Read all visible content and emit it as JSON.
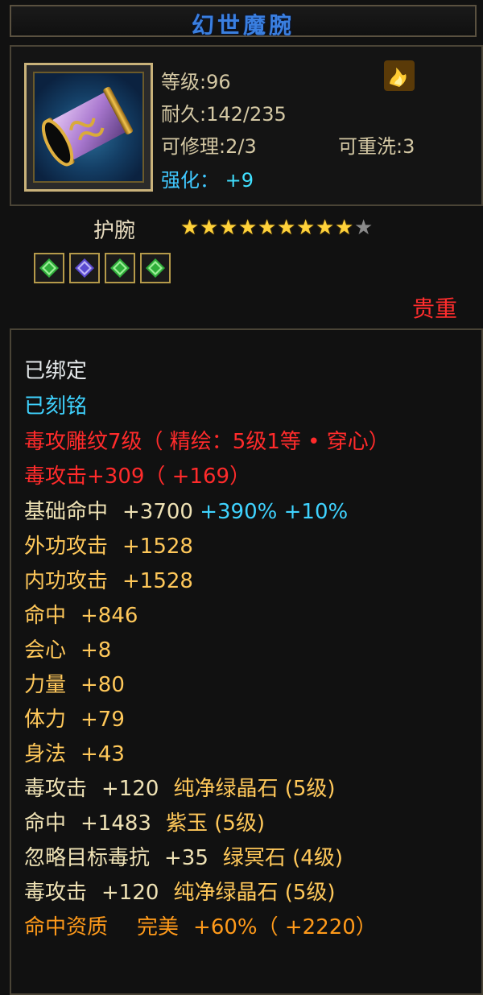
{
  "title": "幻世魔腕",
  "header": {
    "level_label": "等级",
    "level_value": "96",
    "durability_label": "耐久",
    "durability_value": "142/235",
    "repair_label": "可修理",
    "repair_value": "2/3",
    "rewash_label": "可重洗",
    "rewash_value": "3",
    "refine_label": "强化：",
    "refine_value": "+9",
    "item_icon": "wristguard-icon",
    "corner_icon": "fire-icon"
  },
  "slot": {
    "name": "护腕",
    "stars_filled": 9,
    "stars_total": 10,
    "gems": [
      "green-gem-icon",
      "purple-gem-icon",
      "green-gem-icon",
      "green-gem-icon"
    ],
    "rarity": "贵重"
  },
  "details": {
    "bound": "已绑定",
    "engraved": "已刻铭",
    "carve": "毒攻雕纹7级（ 精绘：5级1等 • 穿心）",
    "poison_attack_main": "毒攻击+309（ +169）",
    "base_hit_label": "基础命中",
    "base_hit_value": "+3700",
    "base_hit_pct": "+390%",
    "base_hit_pct2": "+10%",
    "ext_attack_label": "外功攻击",
    "ext_attack_value": "+1528",
    "int_attack_label": "内功攻击",
    "int_attack_value": "+1528",
    "hit_label": "命中",
    "hit_value": "+846",
    "crit_label": "会心",
    "crit_value": "+8",
    "str_label": "力量",
    "str_value": "+80",
    "vit_label": "体力",
    "vit_value": "+79",
    "agi_label": "身法",
    "agi_value": "+43",
    "gem1_label": "毒攻击",
    "gem1_value": "+120",
    "gem1_name": "纯净绿晶石 (5级)",
    "gem2_label": "命中",
    "gem2_value": "+1483",
    "gem2_name": "紫玉 (5级)",
    "gem3_label": "忽略目标毒抗",
    "gem3_value": "+35",
    "gem3_name": "绿冥石 (4级)",
    "gem4_label": "毒攻击",
    "gem4_value": "+120",
    "gem4_name": "纯净绿晶石 (5级)",
    "quality_label": "命中资质",
    "quality_grade": "完美",
    "quality_value": "+60%（ +2220）"
  },
  "colors": {
    "title": "#3a7fe0",
    "white": "#e4e8ea",
    "cyan": "#3fd3ff",
    "red": "#ff2b2b",
    "cream": "#efe2b5",
    "yellow": "#ffc85a",
    "orange": "#ff9a1a"
  }
}
